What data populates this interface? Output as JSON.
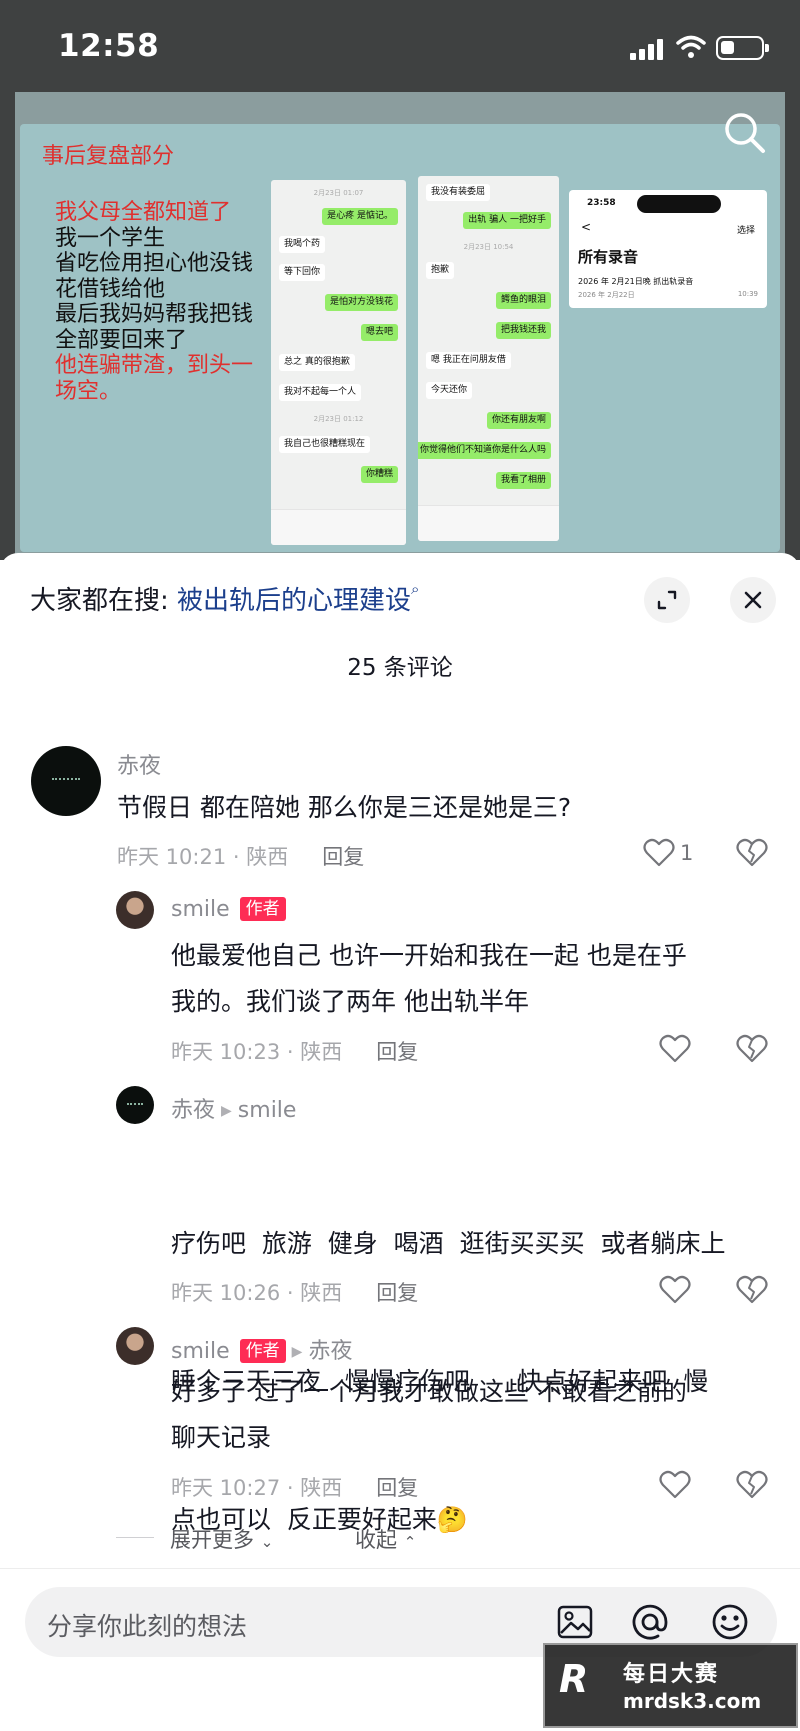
{
  "status_bar": {
    "time": "12:58"
  },
  "video": {
    "slide_title": "事后复盘部分",
    "story_lines": [
      {
        "text": "我父母全都知道了",
        "red": true
      },
      {
        "text": "我一个学生",
        "red": false
      },
      {
        "text": "省吃俭用担心他没钱",
        "red": false
      },
      {
        "text": "花借钱给他",
        "red": false
      },
      {
        "text": "最后我妈妈帮我把钱",
        "red": false
      },
      {
        "text": "全部要回来了",
        "red": false
      },
      {
        "text": "他连骗带渣，到头一",
        "red": true
      },
      {
        "text": "场空。",
        "red": true
      }
    ],
    "chat1": {
      "timestamps": [
        "2月23日 01:07",
        "2月23日 01:12"
      ],
      "messages": [
        "是心疼 是惦记。",
        "我喝个药",
        "等下回你",
        "是怕对方没钱花",
        "嗯去吧",
        "总之 真的很抱歉",
        "我对不起每一个人",
        "我自己也很糟糕现在",
        "你糟糕"
      ]
    },
    "chat2": {
      "timestamps": [
        "2月23日 10:54"
      ],
      "messages": [
        "我没有装委屈",
        "出轨 骗人 一把好手",
        "抱歉",
        "鳄鱼的眼泪",
        "把我钱还我",
        "嗯 我正在问朋友借",
        "今天还你",
        "你还有朋友啊",
        "你觉得他们不知道你是什么人吗",
        "我看了相册"
      ]
    },
    "recording_card": {
      "time": "23:58",
      "back": "<",
      "select": "选择",
      "title": "所有录音",
      "item": "2026 年 2月21日晚 抓出轨录音",
      "date": "2026 年 2月22日",
      "duration": "10:39"
    }
  },
  "sheet": {
    "search_prefix": "大家都在搜:",
    "search_keyword": "被出轨后的心理建设",
    "comment_count": "25 条评论",
    "comments": [
      {
        "name": "赤夜",
        "text": "节假日 都在陪她 那么你是三还是她是三?",
        "meta": "昨天 10:21 · 陕西",
        "reply_label": "回复",
        "like_count": "1"
      }
    ],
    "replies": [
      {
        "name": "smile",
        "badge": "作者",
        "text_lines": [
          "他最爱他自己 也许一开始和我在一起 也是在乎",
          "我的。我们谈了两年 他出轨半年"
        ],
        "meta": "昨天 10:23 · 陕西",
        "reply_label": "回复"
      },
      {
        "name": "赤夜",
        "to": "smile",
        "text_lines": [
          "疗伤吧  旅游  健身  喝酒  逛街买买买  或者躺床上",
          "睡个三天三夜   慢慢疗伤吧      快点好起来吧  慢",
          "点也可以  反正要好起来🤔"
        ],
        "meta": "昨天 10:26 · 陕西",
        "reply_label": "回复"
      },
      {
        "name": "smile",
        "badge": "作者",
        "to": "赤夜",
        "text_lines": [
          "好多了  过了一个月我才敢做这些  不敢看之前的",
          "聊天记录"
        ],
        "meta": "昨天 10:27 · 陕西",
        "reply_label": "回复"
      }
    ],
    "expand_label": "展开更多",
    "collapse_label": "收起"
  },
  "input": {
    "placeholder": "分享你此刻的想法"
  },
  "watermark": {
    "logo": "R",
    "cn": "每日大赛",
    "url": "mrdsk3.com"
  },
  "colors": {
    "accent_red": "#fe2c55",
    "keyword_blue": "#1c3f8c",
    "chat_green": "#95ec69"
  }
}
